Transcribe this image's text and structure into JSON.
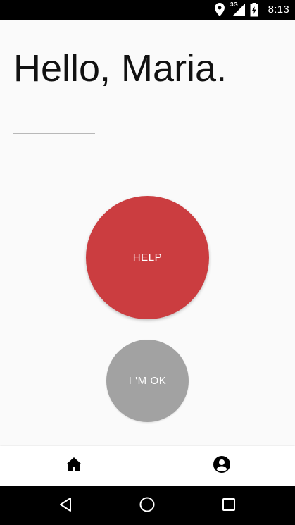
{
  "status_bar": {
    "time": "8:13",
    "network_label": "3G",
    "icons": [
      "location-icon",
      "signal-3g-icon",
      "battery-charging-icon"
    ]
  },
  "greeting": {
    "text": "Hello, Maria."
  },
  "actions": {
    "help_label": "HELP",
    "ok_label": "I 'M OK",
    "help_color": "#cb3d40",
    "ok_color": "#a2a2a2"
  },
  "bottom_nav": {
    "items": [
      {
        "name": "home",
        "icon": "home-icon"
      },
      {
        "name": "profile",
        "icon": "account-circle-icon"
      }
    ]
  },
  "system_nav": {
    "buttons": [
      "back-icon",
      "home-circle-icon",
      "recents-icon"
    ]
  }
}
